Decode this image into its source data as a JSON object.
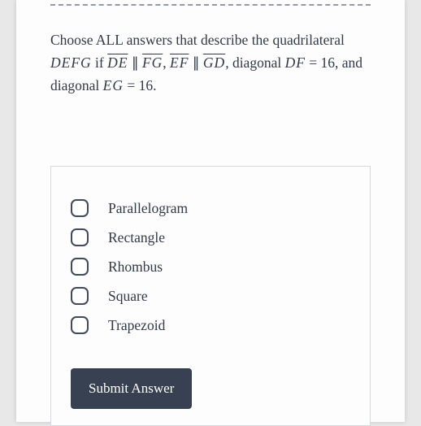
{
  "question": {
    "lead": "Choose ALL answers that describe the quadrilateral ",
    "quad": "DEFG",
    "if_text": " if ",
    "seg1a": "DE",
    "par": " ∥ ",
    "seg1b": "FG",
    "comma1": ", ",
    "seg2a": "EF",
    "seg2b": "GD",
    "diag1_lead": ", diagonal ",
    "diag1_name": "DF",
    "eq": " = ",
    "diag1_val": "16",
    "and_diag": ", and diagonal ",
    "diag2_name": "EG",
    "diag2_val": "16",
    "period": "."
  },
  "options": [
    {
      "label": "Parallelogram"
    },
    {
      "label": "Rectangle"
    },
    {
      "label": "Rhombus"
    },
    {
      "label": "Square"
    },
    {
      "label": "Trapezoid"
    }
  ],
  "submit_label": "Submit Answer"
}
